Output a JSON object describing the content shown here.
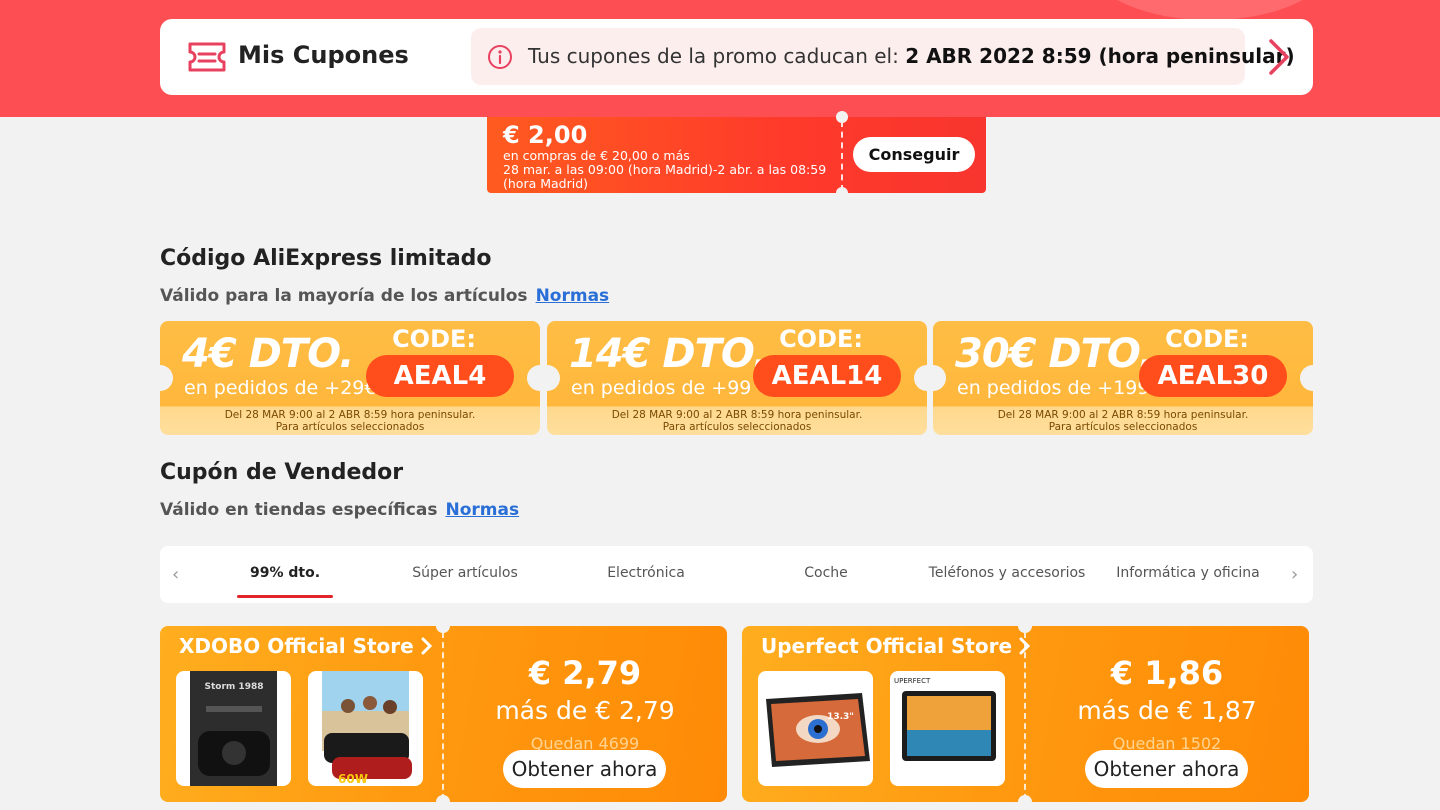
{
  "header": {
    "title": "Mis Cupones",
    "notice_prefix": "Tus cupones de la promo caducan el:",
    "notice_date": "2 ABR 2022 8:59 (hora peninsular)"
  },
  "red_coupon": {
    "amount": "€ 2,00",
    "condition": "en compras de € 20,00 o más",
    "period_line1": "28 mar. a las 09:00 (hora Madrid)-2 abr. a las 08:59",
    "period_line2": "(hora Madrid)",
    "button": "Conseguir"
  },
  "aliexpress_section": {
    "title": "Código AliExpress limitado",
    "subtitle": "Válido para la mayoría de los artículos",
    "rules_link": "Normas",
    "codes": [
      {
        "discount": "4€ DTO.",
        "minimum": "en pedidos de +29€",
        "code_label": "CODE:",
        "code": "AEAL4",
        "foot1": "Del 28 MAR 9:00 al 2 ABR 8:59 hora peninsular.",
        "foot2": "Para artículos seleccionados"
      },
      {
        "discount": "14€ DTO.",
        "minimum": "en pedidos de +99 €",
        "code_label": "CODE:",
        "code": "AEAL14",
        "foot1": "Del 28 MAR 9:00 al 2 ABR 8:59 hora peninsular.",
        "foot2": "Para artículos seleccionados"
      },
      {
        "discount": "30€ DTO.",
        "minimum": "en pedidos de +199€",
        "code_label": "CODE:",
        "code": "AEAL30",
        "foot1": "Del 28 MAR 9:00 al 2 ABR 8:59 hora peninsular.",
        "foot2": "Para artículos seleccionados"
      }
    ]
  },
  "seller_section": {
    "title": "Cupón de Vendedor",
    "subtitle": "Válido en tiendas específicas",
    "rules_link": "Normas"
  },
  "tabs": {
    "items": [
      {
        "label": "99% dto.",
        "active": true
      },
      {
        "label": "Súper artículos",
        "active": false
      },
      {
        "label": "Electrónica",
        "active": false
      },
      {
        "label": "Coche",
        "active": false
      },
      {
        "label": "Teléfonos y accesorios",
        "active": false
      },
      {
        "label": "Informática y oficina",
        "active": false
      }
    ]
  },
  "stores": [
    {
      "name": "XDOBO Official Store",
      "price": "€ 2,79",
      "minimum": "más de € 2,79",
      "remaining": "Quedan 4699",
      "button": "Obtener ahora",
      "thumb1_text": "Storm 1988",
      "thumb2_text": "60W"
    },
    {
      "name": "Uperfect Official Store",
      "price": "€ 1,86",
      "minimum": "más de € 1,87",
      "remaining": "Quedan 1502",
      "button": "Obtener ahora",
      "thumb1_text": "13.3\"",
      "thumb2_text": "UPERFECT"
    }
  ],
  "colors": {
    "brand_red": "#fd4f53",
    "coupon_red": "#ff3a2b",
    "code_orange": "#ffb73c",
    "store_orange": "#ff9a10",
    "link_blue": "#2a6fd8"
  }
}
